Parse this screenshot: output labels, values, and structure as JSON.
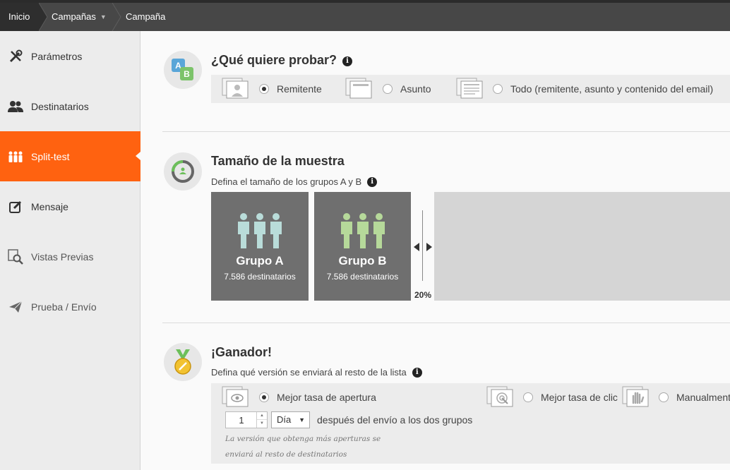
{
  "breadcrumb": {
    "home": "Inicio",
    "campaigns": "Campañas",
    "campaign": "Campaña"
  },
  "sidebar": {
    "items": [
      {
        "label": "Parámetros",
        "icon": "tools-icon"
      },
      {
        "label": "Destinatarios",
        "icon": "users-icon"
      },
      {
        "label": "Split-test",
        "icon": "split-test-icon",
        "active": true
      },
      {
        "label": "Mensaje",
        "icon": "edit-icon"
      },
      {
        "label": "Vistas Previas",
        "icon": "preview-search-icon"
      },
      {
        "label": "Prueba / Envío",
        "icon": "paper-plane-icon"
      }
    ]
  },
  "test_section": {
    "title": "¿Qué quiere probar?",
    "options": [
      {
        "label": "Remitente",
        "selected": true
      },
      {
        "label": "Asunto",
        "selected": false
      },
      {
        "label": "Todo (remitente, asunto y contenido del email)",
        "selected": false
      }
    ]
  },
  "sample_section": {
    "title": "Tamaño de la muestra",
    "subtitle": "Defina el tamaño de los grupos A y B",
    "group_a": {
      "name": "Grupo A",
      "count": "7.586 destinatarios"
    },
    "group_b": {
      "name": "Grupo B",
      "count": "7.586 destinatarios"
    },
    "percent": "20%"
  },
  "winner_section": {
    "title": "¡Ganador!",
    "subtitle": "Defina qué versión se enviará al resto de la lista",
    "options": [
      {
        "label": "Mejor tasa de apertura",
        "selected": true
      },
      {
        "label": "Mejor tasa de clic",
        "selected": false
      },
      {
        "label": "Manualmente",
        "selected": false
      }
    ],
    "delay_value": "1",
    "unit": "Día",
    "after_text": "después del envío a los dos grupos",
    "note_line1": "La versión que obtenga más aperturas se",
    "note_line2": "enviará al resto de destinatarios"
  },
  "colors": {
    "accent": "#ff6210",
    "group_a_people": "#b9dcd9",
    "group_b_people": "#b6d99a"
  }
}
